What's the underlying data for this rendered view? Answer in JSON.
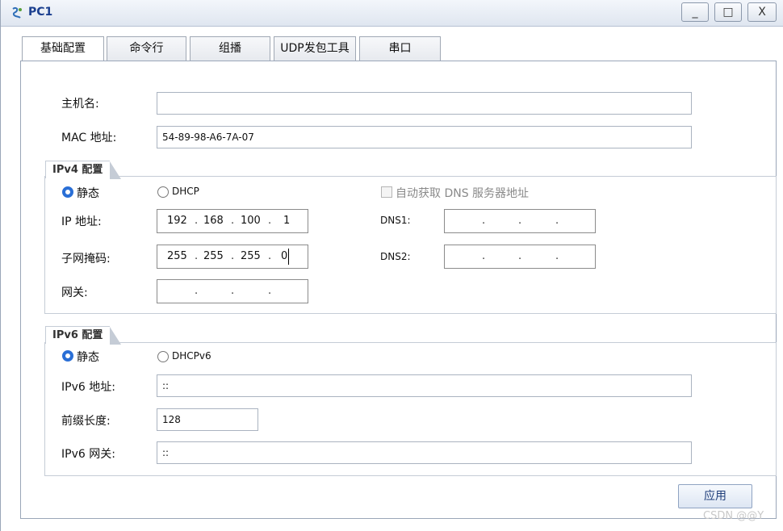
{
  "window": {
    "title": "PC1"
  },
  "controls": {
    "minimize": "_",
    "maximize": "□",
    "close": "X"
  },
  "tabs": [
    "基础配置",
    "命令行",
    "组播",
    "UDP发包工具",
    "串口"
  ],
  "basic": {
    "hostname_label": "主机名:",
    "hostname_value": "",
    "mac_label": "MAC 地址:",
    "mac_value": "54-89-98-A6-7A-07"
  },
  "ipv4": {
    "group_title": "IPv4 配置",
    "static_label": "静态",
    "dhcp_label": "DHCP",
    "auto_dns_label": "自动获取 DNS 服务器地址",
    "ip_label": "IP 地址:",
    "ip": [
      "192",
      "168",
      "100",
      "1"
    ],
    "mask_label": "子网掩码:",
    "mask": [
      "255",
      "255",
      "255",
      "0"
    ],
    "gateway_label": "网关:",
    "gateway": [
      "",
      "",
      "",
      ""
    ],
    "dns1_label": "DNS1:",
    "dns1": [
      "",
      "",
      "",
      ""
    ],
    "dns2_label": "DNS2:",
    "dns2": [
      "",
      "",
      "",
      ""
    ]
  },
  "ipv6": {
    "group_title": "IPv6 配置",
    "static_label": "静态",
    "dhcpv6_label": "DHCPv6",
    "addr_label": "IPv6 地址:",
    "addr_value": "::",
    "prefix_label": "前缀长度:",
    "prefix_value": "128",
    "gateway_label": "IPv6 网关:",
    "gateway_value": "::"
  },
  "apply_label": "应用",
  "watermark": "CSDN @@Y"
}
